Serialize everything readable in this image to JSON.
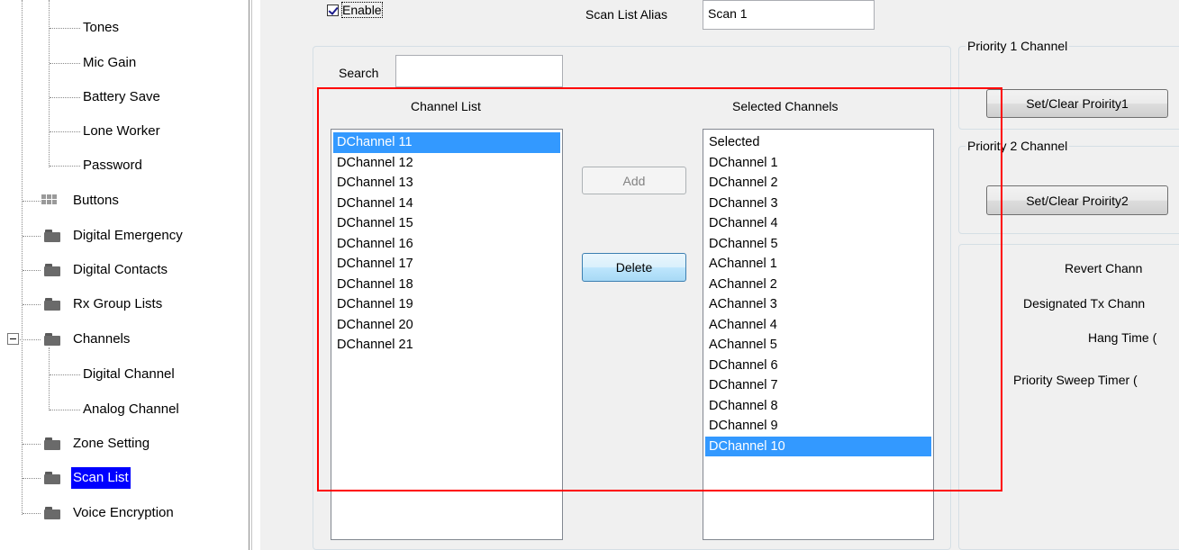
{
  "tree": {
    "items": [
      {
        "label": "Tones",
        "level": 2
      },
      {
        "label": "Mic Gain",
        "level": 2
      },
      {
        "label": "Battery Save",
        "level": 2
      },
      {
        "label": "Lone Worker",
        "level": 2
      },
      {
        "label": "Password",
        "level": 2
      },
      {
        "label": "Buttons",
        "level": 1,
        "icon": "grid-icon"
      },
      {
        "label": "Digital Emergency",
        "level": 1,
        "icon": "folder-icon"
      },
      {
        "label": "Digital Contacts",
        "level": 1,
        "icon": "folder-icon"
      },
      {
        "label": "Rx Group Lists",
        "level": 1,
        "icon": "folder-icon"
      },
      {
        "label": "Channels",
        "level": 1,
        "icon": "folder-icon",
        "expanded": true
      },
      {
        "label": "Digital Channel",
        "level": 2
      },
      {
        "label": "Analog Channel",
        "level": 2
      },
      {
        "label": "Zone Setting",
        "level": 1,
        "icon": "folder-icon"
      },
      {
        "label": "Scan List",
        "level": 1,
        "icon": "folder-icon",
        "selected": true
      },
      {
        "label": "Voice Encryption",
        "level": 1,
        "icon": "folder-icon"
      }
    ]
  },
  "form": {
    "enable_label": "Enable",
    "enable_checked": true,
    "alias_label": "Scan List Alias",
    "alias_value": "Scan 1",
    "search_label": "Search",
    "search_value": "",
    "channel_list_label": "Channel List",
    "selected_channels_label": "Selected Channels",
    "add_label": "Add",
    "delete_label": "Delete"
  },
  "channel_list": [
    "DChannel 11",
    "DChannel 12",
    "DChannel 13",
    "DChannel 14",
    "DChannel 15",
    "DChannel 16",
    "DChannel 17",
    "DChannel 18",
    "DChannel 19",
    "DChannel 20",
    "DChannel 21"
  ],
  "channel_list_selected_index": 0,
  "selected_channels": [
    "Selected",
    "DChannel 1",
    "DChannel 2",
    "DChannel 3",
    "DChannel 4",
    "DChannel 5",
    "AChannel 1",
    "AChannel 2",
    "AChannel 3",
    "AChannel 4",
    "AChannel 5",
    "DChannel 6",
    "DChannel 7",
    "DChannel 8",
    "DChannel 9",
    "DChannel 10"
  ],
  "selected_channels_selected_index": 15,
  "priority": {
    "p1_title": "Priority 1 Channel",
    "p1_button": "Set/Clear Proirity1",
    "p2_title": "Priority 2 Channel",
    "p2_button": "Set/Clear Proirity2"
  },
  "right_labels": {
    "revert": "Revert Chann",
    "designated_tx": "Designated Tx Chann",
    "hang_time": "Hang Time (",
    "sweep_timer": "Priority Sweep Timer ("
  },
  "colors": {
    "tree_selection": "#0000ff",
    "list_selection": "#3399ff",
    "highlight_box": "#ff0000"
  }
}
